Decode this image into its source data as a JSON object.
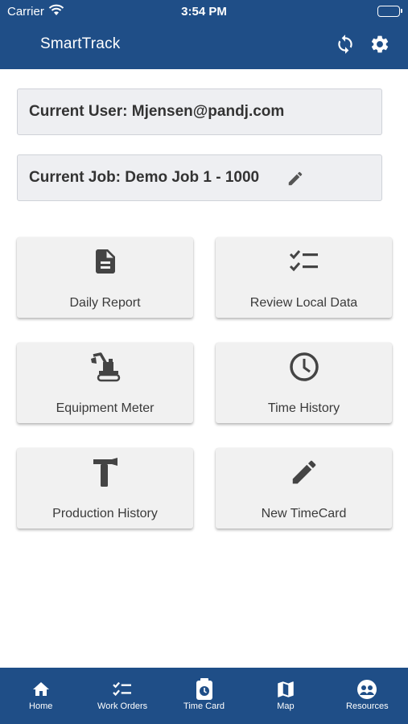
{
  "status_bar": {
    "carrier": "Carrier",
    "time": "3:54 PM"
  },
  "app_bar": {
    "title": "SmartTrack",
    "sync_icon": "sync-icon",
    "settings_icon": "gear-icon"
  },
  "info": {
    "current_user": "Current User: Mjensen@pandj.com",
    "current_job": "Current Job: Demo Job 1 - 1000"
  },
  "tiles": [
    {
      "label": "Daily Report",
      "icon": "document-icon"
    },
    {
      "label": "Review Local Data",
      "icon": "checklist-icon"
    },
    {
      "label": "Equipment Meter",
      "icon": "excavator-icon"
    },
    {
      "label": "Time History",
      "icon": "clock-icon"
    },
    {
      "label": "Production History",
      "icon": "hammer-icon"
    },
    {
      "label": "New TimeCard",
      "icon": "pencil-icon"
    }
  ],
  "bottom_nav": [
    {
      "label": "Home",
      "icon": "home-icon"
    },
    {
      "label": "Work Orders",
      "icon": "checklist-icon"
    },
    {
      "label": "Time Card",
      "icon": "timecard-icon"
    },
    {
      "label": "Map",
      "icon": "map-icon"
    },
    {
      "label": "Resources",
      "icon": "resources-icon"
    }
  ],
  "colors": {
    "brand": "#1f4e87",
    "tile_bg": "#f1f1f1",
    "info_bg": "#eeeff2"
  }
}
